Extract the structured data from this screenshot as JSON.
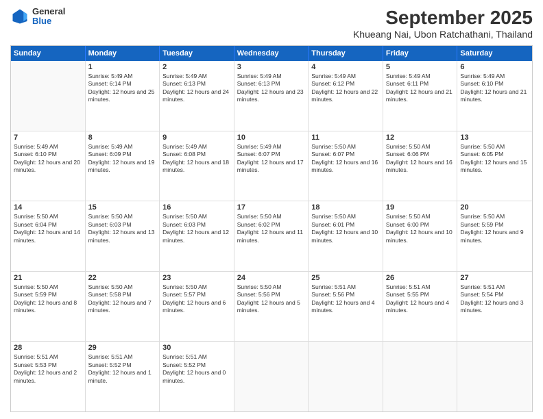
{
  "logo": {
    "general": "General",
    "blue": "Blue"
  },
  "header": {
    "title": "September 2025",
    "subtitle": "Khueang Nai, Ubon Ratchathani, Thailand"
  },
  "days": [
    "Sunday",
    "Monday",
    "Tuesday",
    "Wednesday",
    "Thursday",
    "Friday",
    "Saturday"
  ],
  "weeks": [
    [
      {
        "day": "",
        "sunrise": "",
        "sunset": "",
        "daylight": ""
      },
      {
        "day": "1",
        "sunrise": "Sunrise: 5:49 AM",
        "sunset": "Sunset: 6:14 PM",
        "daylight": "Daylight: 12 hours and 25 minutes."
      },
      {
        "day": "2",
        "sunrise": "Sunrise: 5:49 AM",
        "sunset": "Sunset: 6:13 PM",
        "daylight": "Daylight: 12 hours and 24 minutes."
      },
      {
        "day": "3",
        "sunrise": "Sunrise: 5:49 AM",
        "sunset": "Sunset: 6:13 PM",
        "daylight": "Daylight: 12 hours and 23 minutes."
      },
      {
        "day": "4",
        "sunrise": "Sunrise: 5:49 AM",
        "sunset": "Sunset: 6:12 PM",
        "daylight": "Daylight: 12 hours and 22 minutes."
      },
      {
        "day": "5",
        "sunrise": "Sunrise: 5:49 AM",
        "sunset": "Sunset: 6:11 PM",
        "daylight": "Daylight: 12 hours and 21 minutes."
      },
      {
        "day": "6",
        "sunrise": "Sunrise: 5:49 AM",
        "sunset": "Sunset: 6:10 PM",
        "daylight": "Daylight: 12 hours and 21 minutes."
      }
    ],
    [
      {
        "day": "7",
        "sunrise": "Sunrise: 5:49 AM",
        "sunset": "Sunset: 6:10 PM",
        "daylight": "Daylight: 12 hours and 20 minutes."
      },
      {
        "day": "8",
        "sunrise": "Sunrise: 5:49 AM",
        "sunset": "Sunset: 6:09 PM",
        "daylight": "Daylight: 12 hours and 19 minutes."
      },
      {
        "day": "9",
        "sunrise": "Sunrise: 5:49 AM",
        "sunset": "Sunset: 6:08 PM",
        "daylight": "Daylight: 12 hours and 18 minutes."
      },
      {
        "day": "10",
        "sunrise": "Sunrise: 5:49 AM",
        "sunset": "Sunset: 6:07 PM",
        "daylight": "Daylight: 12 hours and 17 minutes."
      },
      {
        "day": "11",
        "sunrise": "Sunrise: 5:50 AM",
        "sunset": "Sunset: 6:07 PM",
        "daylight": "Daylight: 12 hours and 16 minutes."
      },
      {
        "day": "12",
        "sunrise": "Sunrise: 5:50 AM",
        "sunset": "Sunset: 6:06 PM",
        "daylight": "Daylight: 12 hours and 16 minutes."
      },
      {
        "day": "13",
        "sunrise": "Sunrise: 5:50 AM",
        "sunset": "Sunset: 6:05 PM",
        "daylight": "Daylight: 12 hours and 15 minutes."
      }
    ],
    [
      {
        "day": "14",
        "sunrise": "Sunrise: 5:50 AM",
        "sunset": "Sunset: 6:04 PM",
        "daylight": "Daylight: 12 hours and 14 minutes."
      },
      {
        "day": "15",
        "sunrise": "Sunrise: 5:50 AM",
        "sunset": "Sunset: 6:03 PM",
        "daylight": "Daylight: 12 hours and 13 minutes."
      },
      {
        "day": "16",
        "sunrise": "Sunrise: 5:50 AM",
        "sunset": "Sunset: 6:03 PM",
        "daylight": "Daylight: 12 hours and 12 minutes."
      },
      {
        "day": "17",
        "sunrise": "Sunrise: 5:50 AM",
        "sunset": "Sunset: 6:02 PM",
        "daylight": "Daylight: 12 hours and 11 minutes."
      },
      {
        "day": "18",
        "sunrise": "Sunrise: 5:50 AM",
        "sunset": "Sunset: 6:01 PM",
        "daylight": "Daylight: 12 hours and 10 minutes."
      },
      {
        "day": "19",
        "sunrise": "Sunrise: 5:50 AM",
        "sunset": "Sunset: 6:00 PM",
        "daylight": "Daylight: 12 hours and 10 minutes."
      },
      {
        "day": "20",
        "sunrise": "Sunrise: 5:50 AM",
        "sunset": "Sunset: 5:59 PM",
        "daylight": "Daylight: 12 hours and 9 minutes."
      }
    ],
    [
      {
        "day": "21",
        "sunrise": "Sunrise: 5:50 AM",
        "sunset": "Sunset: 5:59 PM",
        "daylight": "Daylight: 12 hours and 8 minutes."
      },
      {
        "day": "22",
        "sunrise": "Sunrise: 5:50 AM",
        "sunset": "Sunset: 5:58 PM",
        "daylight": "Daylight: 12 hours and 7 minutes."
      },
      {
        "day": "23",
        "sunrise": "Sunrise: 5:50 AM",
        "sunset": "Sunset: 5:57 PM",
        "daylight": "Daylight: 12 hours and 6 minutes."
      },
      {
        "day": "24",
        "sunrise": "Sunrise: 5:50 AM",
        "sunset": "Sunset: 5:56 PM",
        "daylight": "Daylight: 12 hours and 5 minutes."
      },
      {
        "day": "25",
        "sunrise": "Sunrise: 5:51 AM",
        "sunset": "Sunset: 5:56 PM",
        "daylight": "Daylight: 12 hours and 4 minutes."
      },
      {
        "day": "26",
        "sunrise": "Sunrise: 5:51 AM",
        "sunset": "Sunset: 5:55 PM",
        "daylight": "Daylight: 12 hours and 4 minutes."
      },
      {
        "day": "27",
        "sunrise": "Sunrise: 5:51 AM",
        "sunset": "Sunset: 5:54 PM",
        "daylight": "Daylight: 12 hours and 3 minutes."
      }
    ],
    [
      {
        "day": "28",
        "sunrise": "Sunrise: 5:51 AM",
        "sunset": "Sunset: 5:53 PM",
        "daylight": "Daylight: 12 hours and 2 minutes."
      },
      {
        "day": "29",
        "sunrise": "Sunrise: 5:51 AM",
        "sunset": "Sunset: 5:52 PM",
        "daylight": "Daylight: 12 hours and 1 minute."
      },
      {
        "day": "30",
        "sunrise": "Sunrise: 5:51 AM",
        "sunset": "Sunset: 5:52 PM",
        "daylight": "Daylight: 12 hours and 0 minutes."
      },
      {
        "day": "",
        "sunrise": "",
        "sunset": "",
        "daylight": ""
      },
      {
        "day": "",
        "sunrise": "",
        "sunset": "",
        "daylight": ""
      },
      {
        "day": "",
        "sunrise": "",
        "sunset": "",
        "daylight": ""
      },
      {
        "day": "",
        "sunrise": "",
        "sunset": "",
        "daylight": ""
      }
    ]
  ]
}
